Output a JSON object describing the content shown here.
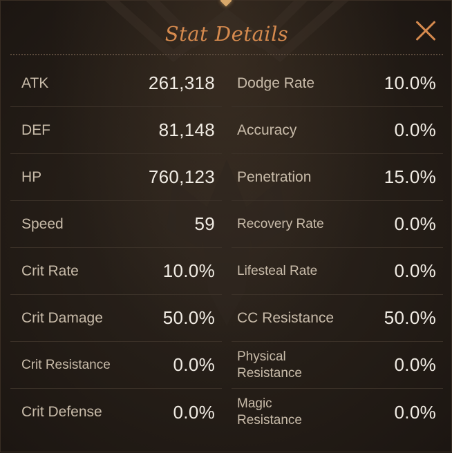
{
  "dialog": {
    "title": "Stat Details"
  },
  "stats_left": [
    {
      "label": "ATK",
      "value": "261,318"
    },
    {
      "label": "DEF",
      "value": "81,148"
    },
    {
      "label": "HP",
      "value": "760,123"
    },
    {
      "label": "Speed",
      "value": "59"
    },
    {
      "label": "Crit Rate",
      "value": "10.0%"
    },
    {
      "label": "Crit Damage",
      "value": "50.0%"
    },
    {
      "label": "Crit Resistance",
      "value": "0.0%"
    },
    {
      "label": "Crit Defense",
      "value": "0.0%"
    }
  ],
  "stats_right": [
    {
      "label": "Dodge Rate",
      "value": "10.0%"
    },
    {
      "label": "Accuracy",
      "value": "0.0%"
    },
    {
      "label": "Penetration",
      "value": "15.0%"
    },
    {
      "label": "Recovery Rate",
      "value": "0.0%"
    },
    {
      "label": "Lifesteal Rate",
      "value": "0.0%"
    },
    {
      "label": "CC Resistance",
      "value": "50.0%"
    },
    {
      "label": "Physical\nResistance",
      "value": "0.0%"
    },
    {
      "label": "Magic\nResistance",
      "value": "0.0%"
    }
  ],
  "colors": {
    "title": "#d68a4e",
    "label": "#c9bcaa",
    "value": "#f1ece4",
    "background": "#231c16"
  },
  "icons": {
    "close": "close-icon"
  }
}
